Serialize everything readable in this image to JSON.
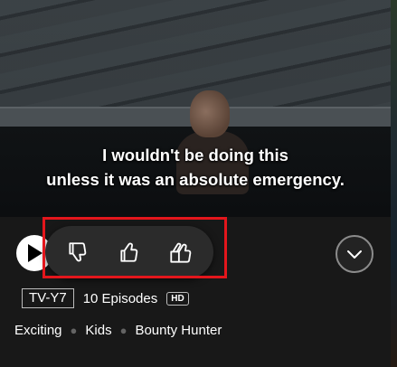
{
  "subtitle": {
    "line1": "I wouldn't be doing this",
    "line2": "unless it was an absolute emergency."
  },
  "controls": {
    "play_icon": "play-icon",
    "rating_icons": [
      "thumbs-down-icon",
      "thumbs-up-icon",
      "double-thumbs-up-icon"
    ],
    "more_icon": "chevron-down-icon",
    "highlight_color": "#e3161c"
  },
  "meta": {
    "maturity": "TV-Y7",
    "episodes": "10 Episodes",
    "quality": "HD"
  },
  "genres": [
    "Exciting",
    "Kids",
    "Bounty Hunter"
  ]
}
